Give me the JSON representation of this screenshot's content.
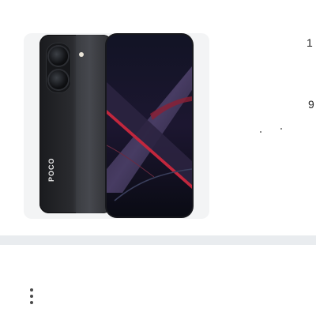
{
  "product": {
    "brand_label": "POCO",
    "image_icon": "phone-product-image"
  },
  "right_panel": {
    "partial_char_top": "1",
    "partial_char_mid": "9"
  },
  "menu": {
    "icon": "more-vertical-icon"
  },
  "colors": {
    "divider": "#e9ecef",
    "image_background": "#f3f4f5",
    "screen_accent": "#c2273d"
  }
}
